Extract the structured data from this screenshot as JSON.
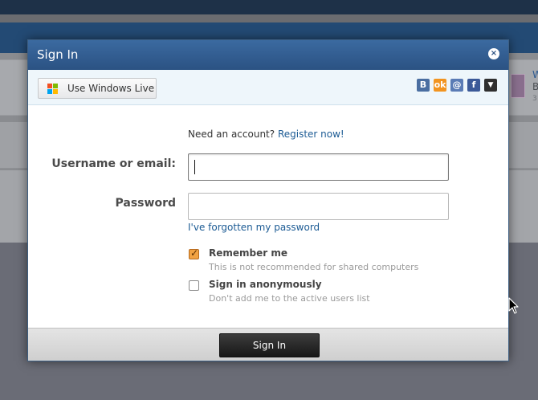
{
  "dialog": {
    "title": "Sign In",
    "close_glyph": "×",
    "windows_live_label": "Use Windows Live",
    "social": [
      {
        "icon": "vk-icon",
        "glyph": "B",
        "color": "#4a6ea1"
      },
      {
        "icon": "odnoklassniki-icon",
        "glyph": "ok",
        "color": "#f29420"
      },
      {
        "icon": "mail-icon",
        "glyph": "@",
        "color": "#5a7bb5"
      },
      {
        "icon": "facebook-icon",
        "glyph": "f",
        "color": "#3b5998"
      },
      {
        "icon": "more-dropdown-icon",
        "glyph": "▼",
        "color": "#2f2f2f"
      }
    ],
    "need_account": "Need an account?",
    "register_link": "Register now!",
    "username_label": "Username or email:",
    "username_value": "",
    "password_label": "Password",
    "password_value": "",
    "forgot_link": "I've forgotten my password",
    "remember_title": "Remember me",
    "remember_desc": "This is not recommended for shared computers",
    "remember_checked": true,
    "anon_title": "Sign in anonymously",
    "anon_desc": "Don't add me to the active users list",
    "anon_checked": false,
    "submit_label": "Sign In"
  },
  "background": {
    "line1": "W",
    "line2": "B",
    "line3": "3"
  }
}
